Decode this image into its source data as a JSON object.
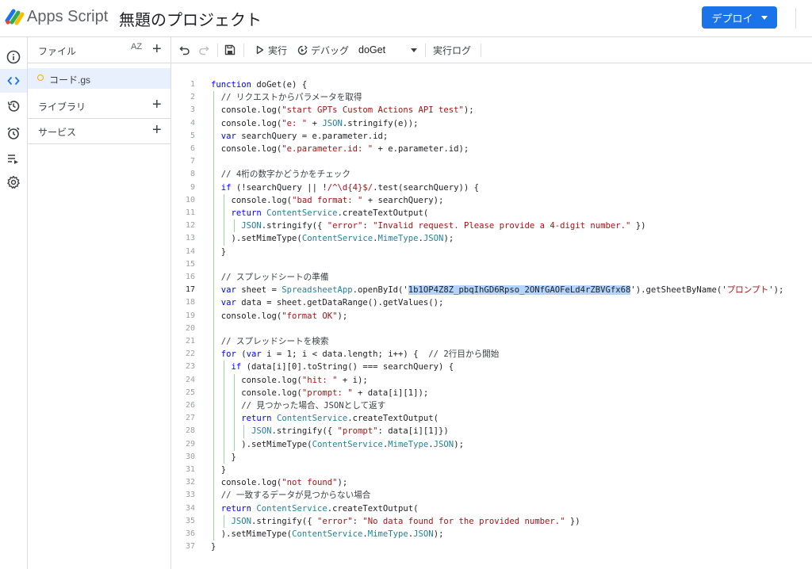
{
  "header": {
    "app_name": "Apps Script",
    "project_title": "無題のプロジェクト",
    "deploy_label": "デプロイ"
  },
  "files_panel": {
    "title": "ファイル",
    "sort_label": "AZ",
    "file_name": "コード.gs",
    "libraries_label": "ライブラリ",
    "services_label": "サービス"
  },
  "toolbar": {
    "run_label": "実行",
    "debug_label": "デバッグ",
    "function_select": "doGet",
    "log_label": "実行ログ"
  },
  "editor": {
    "active_line": 17,
    "lines": [
      [
        [
          "k",
          "function"
        ],
        [
          "p",
          " doGet(e) {"
        ]
      ],
      [
        [
          "c",
          "  // リクエストからパラメータを取得"
        ]
      ],
      [
        [
          "p",
          "  console.log("
        ],
        [
          "s",
          "\"start GPTs Custom Actions API test\""
        ],
        [
          "p",
          ");"
        ]
      ],
      [
        [
          "p",
          "  console.log("
        ],
        [
          "s",
          "\"e: \""
        ],
        [
          "p",
          " + "
        ],
        [
          "t",
          "JSON"
        ],
        [
          "p",
          ".stringify(e));"
        ]
      ],
      [
        [
          "k",
          "  var"
        ],
        [
          "p",
          " searchQuery = e.parameter.id;"
        ]
      ],
      [
        [
          "p",
          "  console.log("
        ],
        [
          "s",
          "\"e.parameter.id: \""
        ],
        [
          "p",
          " + e.parameter.id);"
        ]
      ],
      [
        [
          "p",
          ""
        ]
      ],
      [
        [
          "c",
          "  // 4桁の数字かどうかをチェック"
        ]
      ],
      [
        [
          "k",
          "  if"
        ],
        [
          "p",
          " (!searchQuery || !"
        ],
        [
          "s",
          "/^\\d{4}$/"
        ],
        [
          "p",
          ".test(searchQuery)) {"
        ]
      ],
      [
        [
          "p",
          "    console.log("
        ],
        [
          "s",
          "\"bad format: \""
        ],
        [
          "p",
          " + searchQuery);"
        ]
      ],
      [
        [
          "k",
          "    return"
        ],
        [
          "p",
          " "
        ],
        [
          "t",
          "ContentService"
        ],
        [
          "p",
          ".createTextOutput("
        ]
      ],
      [
        [
          "p",
          "      "
        ],
        [
          "t",
          "JSON"
        ],
        [
          "p",
          ".stringify({ "
        ],
        [
          "s",
          "\"error\""
        ],
        [
          "p",
          ": "
        ],
        [
          "s",
          "\"Invalid request. Please provide a 4-digit number.\""
        ],
        [
          "p",
          " })"
        ]
      ],
      [
        [
          "p",
          "    ).setMimeType("
        ],
        [
          "t",
          "ContentService"
        ],
        [
          "p",
          "."
        ],
        [
          "t",
          "MimeType"
        ],
        [
          "p",
          "."
        ],
        [
          "t",
          "JSON"
        ],
        [
          "p",
          ");"
        ]
      ],
      [
        [
          "p",
          "  }"
        ]
      ],
      [
        [
          "p",
          ""
        ]
      ],
      [
        [
          "c",
          "  // スプレッドシートの準備"
        ]
      ],
      [
        [
          "k",
          "  var"
        ],
        [
          "p",
          " sheet = "
        ],
        [
          "t",
          "SpreadsheetApp"
        ],
        [
          "p",
          ".openById('"
        ],
        [
          "hl",
          "1b1OP4Z8Z_pbqIhGD6Rpso_2ONfGAOFeLd4rZBVGfx68"
        ],
        [
          "p",
          "').getSheetByName('"
        ],
        [
          "s",
          "プロンプト"
        ],
        [
          "p",
          "');"
        ]
      ],
      [
        [
          "k",
          "  var"
        ],
        [
          "p",
          " data = sheet.getDataRange().getValues();"
        ]
      ],
      [
        [
          "p",
          "  console.log("
        ],
        [
          "s",
          "\"format OK\""
        ],
        [
          "p",
          ");"
        ]
      ],
      [
        [
          "p",
          ""
        ]
      ],
      [
        [
          "c",
          "  // スプレッドシートを検索"
        ]
      ],
      [
        [
          "k",
          "  for"
        ],
        [
          "p",
          " ("
        ],
        [
          "k",
          "var"
        ],
        [
          "p",
          " i = 1; i < data.length; i++) {  "
        ],
        [
          "c",
          "// 2行目から開始"
        ]
      ],
      [
        [
          "k",
          "    if"
        ],
        [
          "p",
          " (data[i][0].toString() === searchQuery) {"
        ]
      ],
      [
        [
          "p",
          "      console.log("
        ],
        [
          "s",
          "\"hit: \""
        ],
        [
          "p",
          " + i);"
        ]
      ],
      [
        [
          "p",
          "      console.log("
        ],
        [
          "s",
          "\"prompt: \""
        ],
        [
          "p",
          " + data[i][1]);"
        ]
      ],
      [
        [
          "c",
          "      // 見つかった場合、JSONとして返す"
        ]
      ],
      [
        [
          "k",
          "      return"
        ],
        [
          "p",
          " "
        ],
        [
          "t",
          "ContentService"
        ],
        [
          "p",
          ".createTextOutput("
        ]
      ],
      [
        [
          "p",
          "        "
        ],
        [
          "t",
          "JSON"
        ],
        [
          "p",
          ".stringify({ "
        ],
        [
          "s",
          "\"prompt\""
        ],
        [
          "p",
          ": data[i][1]})"
        ]
      ],
      [
        [
          "p",
          "      ).setMimeType("
        ],
        [
          "t",
          "ContentService"
        ],
        [
          "p",
          "."
        ],
        [
          "t",
          "MimeType"
        ],
        [
          "p",
          "."
        ],
        [
          "t",
          "JSON"
        ],
        [
          "p",
          ");"
        ]
      ],
      [
        [
          "p",
          "    }"
        ]
      ],
      [
        [
          "p",
          "  }"
        ]
      ],
      [
        [
          "p",
          "  console.log("
        ],
        [
          "s",
          "\"not found\""
        ],
        [
          "p",
          ");"
        ]
      ],
      [
        [
          "c",
          "  // 一致するデータが見つからない場合"
        ]
      ],
      [
        [
          "k",
          "  return"
        ],
        [
          "p",
          " "
        ],
        [
          "t",
          "ContentService"
        ],
        [
          "p",
          ".createTextOutput("
        ]
      ],
      [
        [
          "p",
          "    "
        ],
        [
          "t",
          "JSON"
        ],
        [
          "p",
          ".stringify({ "
        ],
        [
          "s",
          "\"error\""
        ],
        [
          "p",
          ": "
        ],
        [
          "s",
          "\"No data found for the provided number.\""
        ],
        [
          "p",
          " })"
        ]
      ],
      [
        [
          "p",
          "  ).setMimeType("
        ],
        [
          "t",
          "ContentService"
        ],
        [
          "p",
          "."
        ],
        [
          "t",
          "MimeType"
        ],
        [
          "p",
          "."
        ],
        [
          "t",
          "JSON"
        ],
        [
          "p",
          ");"
        ]
      ],
      [
        [
          "p",
          "}"
        ]
      ]
    ]
  },
  "colors": {
    "accent": "#1a73e8",
    "keyword": "#0000ff",
    "string": "#a31515",
    "type": "#267f99",
    "selection": "#b3d4fc"
  }
}
